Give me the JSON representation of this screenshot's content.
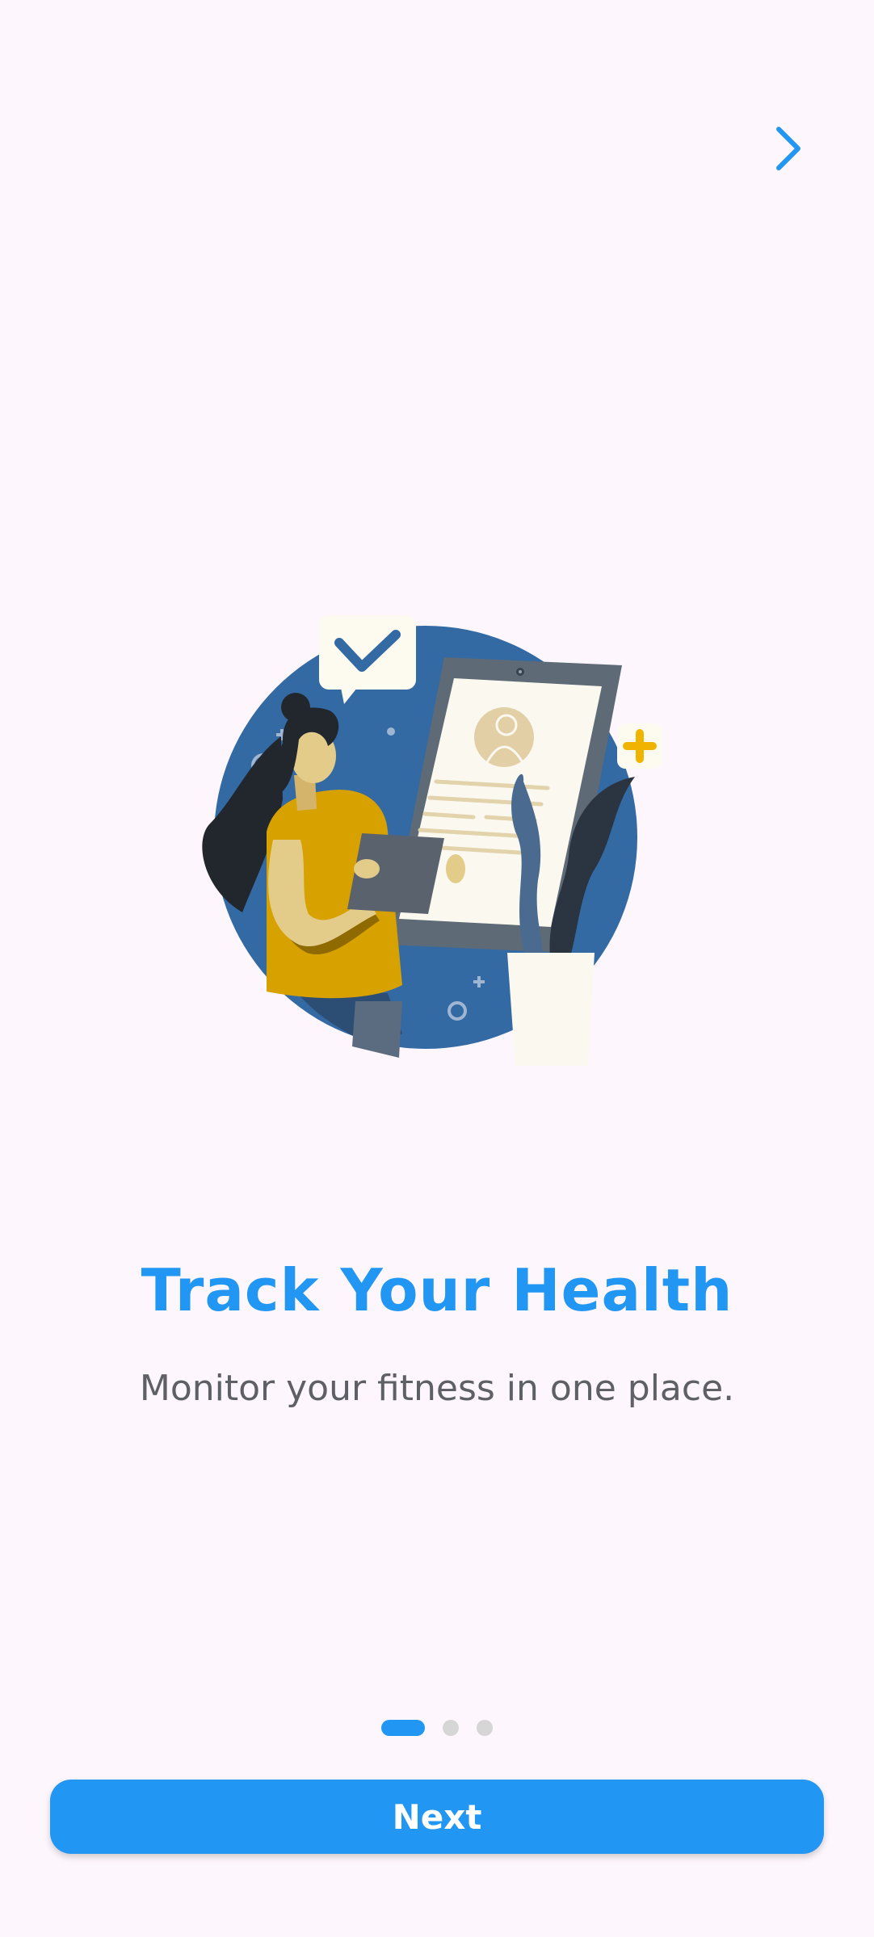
{
  "onboarding": {
    "title": "Track Your Health",
    "subtitle": "Monitor your fitness in one place.",
    "next_label": "Next",
    "pages_total": 3,
    "current_page": 1
  },
  "icons": {
    "skip": "chevron-right-icon"
  },
  "colors": {
    "accent": "#2196f3",
    "background": "#fdf6fc",
    "subtitle_text": "#5f5f66",
    "dot_inactive": "#d6d6d6"
  }
}
